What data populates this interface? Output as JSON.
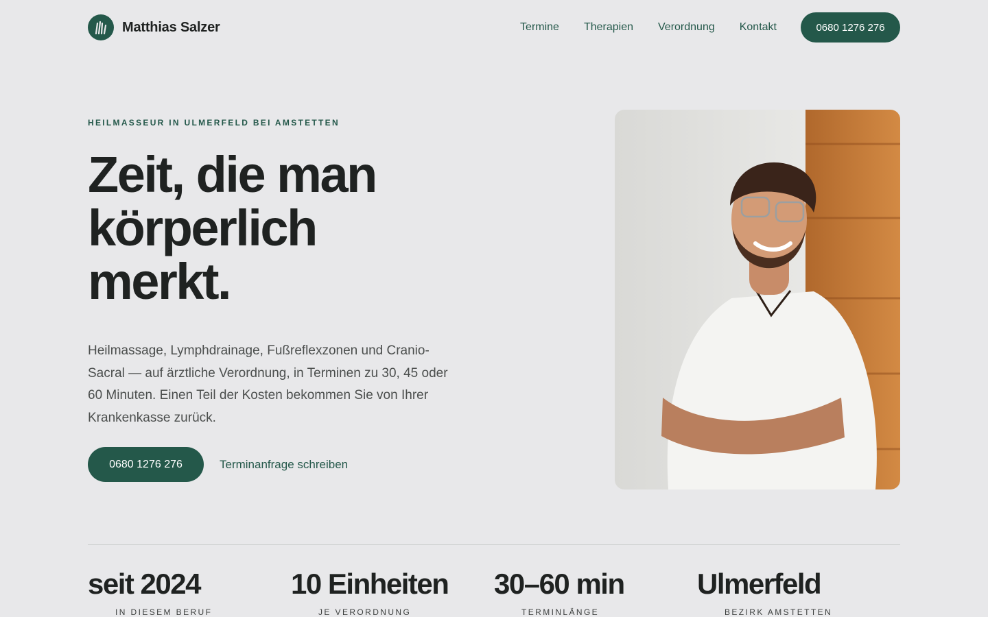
{
  "header": {
    "brand_name": "Matthias Salzer",
    "nav": [
      {
        "label": "Termine"
      },
      {
        "label": "Therapien"
      },
      {
        "label": "Verordnung"
      },
      {
        "label": "Kontakt"
      }
    ],
    "cta_label": "0680 1276 276"
  },
  "hero": {
    "eyebrow": "HEILMASSEUR IN ULMERFELD BEI AMSTETTEN",
    "headline_line1": "Zeit, die man",
    "headline_line2": "körperlich",
    "headline_line3": "merkt.",
    "lead": "Heilmassage, Lymphdrainage, Fußreflexzonen und Cranio-Sacral — auf ärztliche Verordnung, in Terminen zu 30, 45 oder 60 Minuten. Einen Teil der Kosten bekommen Sie von Ihrer Krankenkasse zurück.",
    "primary_button": "0680 1276 276",
    "secondary_link": "Terminanfrage schreiben"
  },
  "stats": [
    {
      "value": "seit 2024",
      "label": "IN DIESEM BERUF"
    },
    {
      "value": "10 Einheiten",
      "label": "JE VERORDNUNG"
    },
    {
      "value": "30–60 min",
      "label": "TERMINLÄNGE"
    },
    {
      "value": "Ulmerfeld",
      "label": "BEZIRK AMSTETTEN"
    }
  ],
  "colors": {
    "background": "#e8e8ea",
    "accent": "#24584a",
    "text": "#1f2221"
  }
}
